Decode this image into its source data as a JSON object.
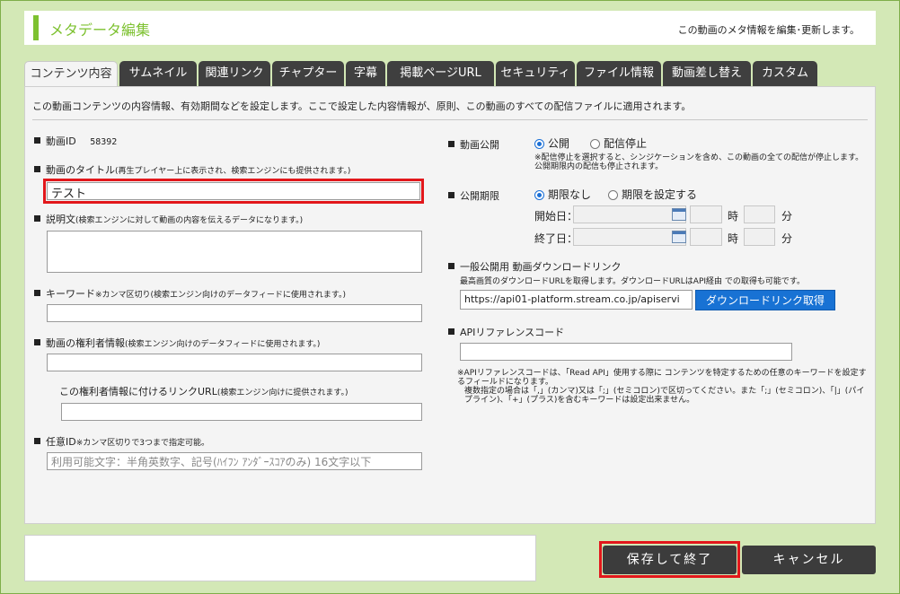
{
  "header": {
    "title": "メタデータ編集",
    "description": "この動画のメタ情報を編集･更新します。"
  },
  "tabs": [
    "コンテンツ内容",
    "サムネイル",
    "関連リンク",
    "チャプター",
    "字幕",
    "掲載ページURL",
    "セキュリティ",
    "ファイル情報",
    "動画差し替え",
    "カスタム"
  ],
  "panel": {
    "intro": "この動画コンテンツの内容情報、有効期間などを設定します。ここで設定した内容情報が、原則、この動画のすべての配信ファイルに適用されます。",
    "video_id": {
      "label": "動画ID",
      "value": "58392"
    },
    "title_field": {
      "label": "動画のタイトル",
      "hint": "(再生プレイヤー上に表示され、検索エンジンにも提供されます。)",
      "value": "テスト"
    },
    "description_field": {
      "label": "説明文",
      "hint": "(検索エンジンに対して動画の内容を伝えるデータになります。)",
      "value": ""
    },
    "keyword_field": {
      "label": "キーワード",
      "hint": "※カンマ区切り(検索エンジン向けのデータフィードに使用されます。)",
      "value": ""
    },
    "rights_field": {
      "label": "動画の権利者情報",
      "hint": "(検索エンジン向けのデータフィードに使用されます。)",
      "value": ""
    },
    "rights_url_field": {
      "label": "この権利者情報に付けるリンクURL",
      "hint": "(検索エンジン向けに提供されます。)",
      "value": ""
    },
    "optional_id_field": {
      "label": "任意ID",
      "hint": "※カンマ区切りで3つまで指定可能。",
      "placeholder": "利用可能文字：半角英数字、記号(ﾊｲﾌﾝ ｱﾝﾀﾞｰｽｺｱのみ) 16文字以下"
    },
    "publish": {
      "label": "動画公開",
      "option_public": "公開",
      "option_stop": "配信停止",
      "note": "※配信停止を選択すると、シンジケーションを含め、この動画の全ての配信が停止します。公開期限内の配信も停止されます。"
    },
    "period": {
      "label": "公開期限",
      "option_none": "期限なし",
      "option_set": "期限を設定する",
      "start_label": "開始日：",
      "end_label": "終了日：",
      "hour_label": "時",
      "minute_label": "分"
    },
    "download": {
      "label": "一般公開用 動画ダウンロードリンク",
      "note": "最高画質のダウンロードURLを取得します。ダウンロードURLはAPI経由 での取得も可能です。",
      "url_value": "https://api01-platform.stream.co.jp/apiservi",
      "button": "ダウンロードリンク取得"
    },
    "api_ref": {
      "label": "APIリファレンスコード",
      "value": "",
      "note1": "※APIリファレンスコードは、「Read API」使用する際に コンテンツを特定するための任意のキーワードを設定するフィールドになります。",
      "note2": "複数指定の場合は「,」(カンマ)又は「;」(セミコロン)で区切ってください。また「;」(セミコロン)、「|」(パイプライン)、「+」(プラス)を含むキーワードは設定出来ません。"
    }
  },
  "footer": {
    "save_button": "保存して終了",
    "cancel_button": "キャンセル"
  },
  "colors": {
    "accent_green": "#7dc130",
    "highlight_red": "#e2171b",
    "button_blue": "#1872d4",
    "button_dark": "#3c3c3c"
  }
}
